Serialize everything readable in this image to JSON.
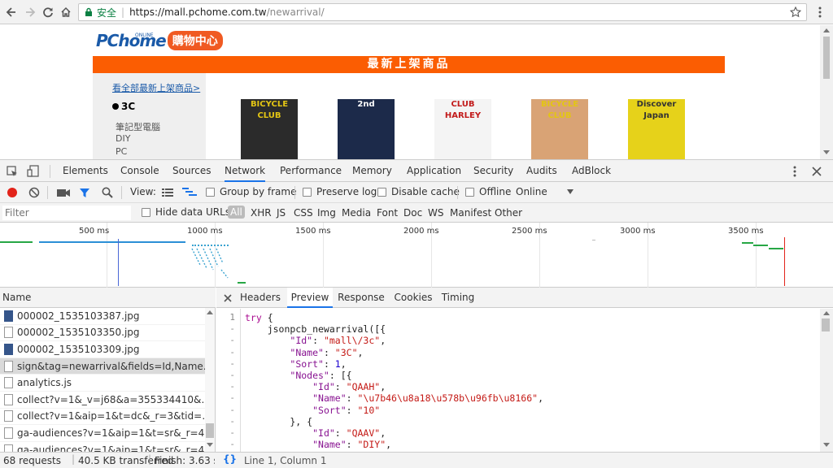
{
  "browser": {
    "security_label": "安全",
    "url_host": "https://mall.pchome.com.tw",
    "url_path": "/newarrival/"
  },
  "page": {
    "logo_text": "PChome",
    "logo_online": "ONLINE",
    "logo_mall": "購物中心",
    "banner": "最新上架商品",
    "all_link": "看全部最新上架商品>",
    "category": "3C",
    "subcategories": [
      "筆記型電腦",
      "DIY",
      "PC"
    ],
    "covers": [
      {
        "title": "BICYCLE CLUB",
        "bg": "#2b2b2b",
        "fg": "#e3c514"
      },
      {
        "title": "2nd",
        "bg": "#1c2a4a",
        "fg": "#ffffff"
      },
      {
        "title": "CLUB HARLEY",
        "bg": "#f4f4f4",
        "fg": "#c21b1b"
      },
      {
        "title": "BICYCLE CLUB",
        "bg": "#d9a375",
        "fg": "#e3c514"
      },
      {
        "title": "Discover Japan",
        "bg": "#e6d21a",
        "fg": "#333333"
      }
    ]
  },
  "devtools": {
    "tabs": [
      "Elements",
      "Console",
      "Sources",
      "Network",
      "Performance",
      "Memory",
      "Application",
      "Security",
      "Audits",
      "AdBlock"
    ],
    "active_tab": "Network",
    "toolbar": {
      "view_label": "View:",
      "group_by_frame": "Group by frame",
      "preserve_log": "Preserve log",
      "disable_cache": "Disable cache",
      "offline": "Offline",
      "throttle": "Online"
    },
    "filter": {
      "placeholder": "Filter",
      "hide_data_urls": "Hide data URLs",
      "types": [
        "All",
        "XHR",
        "JS",
        "CSS",
        "Img",
        "Media",
        "Font",
        "Doc",
        "WS",
        "Manifest",
        "Other"
      ]
    },
    "timeline_ticks": [
      "500 ms",
      "1000 ms",
      "1500 ms",
      "2000 ms",
      "2500 ms",
      "3000 ms",
      "3500 ms"
    ],
    "requests_header": "Name",
    "requests": [
      {
        "name": "000002_1535103387.jpg",
        "type": "img"
      },
      {
        "name": "000002_1535103350.jpg",
        "type": "doc"
      },
      {
        "name": "000002_1535103309.jpg",
        "type": "img"
      },
      {
        "name": "sign&tag=newarrival&fields=Id,Name,Sort,...",
        "type": "doc",
        "selected": true
      },
      {
        "name": "analytics.js",
        "type": "doc"
      },
      {
        "name": "collect?v=1&_v=j68&a=355334410&t=page",
        "type": "doc"
      },
      {
        "name": "collect?v=1&aip=1&t=dc&_r=3&tid=UA-11...",
        "type": "doc"
      },
      {
        "name": "ga-audiences?v=1&aip=1&t=sr&_r=4&tid=...",
        "type": "doc"
      },
      {
        "name": "ga-audiences?v=1&aip=1&t=sr&_r=4&tid=...",
        "type": "doc"
      }
    ],
    "detail_tabs": [
      "Headers",
      "Preview",
      "Response",
      "Cookies",
      "Timing"
    ],
    "active_detail_tab": "Preview",
    "code": {
      "gutter": [
        "1",
        "-",
        "-",
        "-",
        "-",
        "-",
        "-",
        "-",
        "-",
        "-",
        "-",
        "-",
        "-"
      ],
      "lines": [
        "try {",
        "    jsonpcb_newarrival([{",
        "        \"Id\": \"mall\\/3c\",",
        "        \"Name\": \"3C\",",
        "        \"Sort\": 1,",
        "        \"Nodes\": [{",
        "            \"Id\": \"QAAH\",",
        "            \"Name\": \"\\u7b46\\u8a18\\u578b\\u96fb\\u8166\",",
        "            \"Sort\": \"10\"",
        "        }, {",
        "            \"Id\": \"QAAV\",",
        "            \"Name\": \"DIY\","
      ]
    },
    "status": {
      "requests": "68 requests",
      "transferred": "40.5 KB transferred",
      "finish": "Finish: 3.63 s...",
      "position": "Line 1, Column 1"
    }
  }
}
